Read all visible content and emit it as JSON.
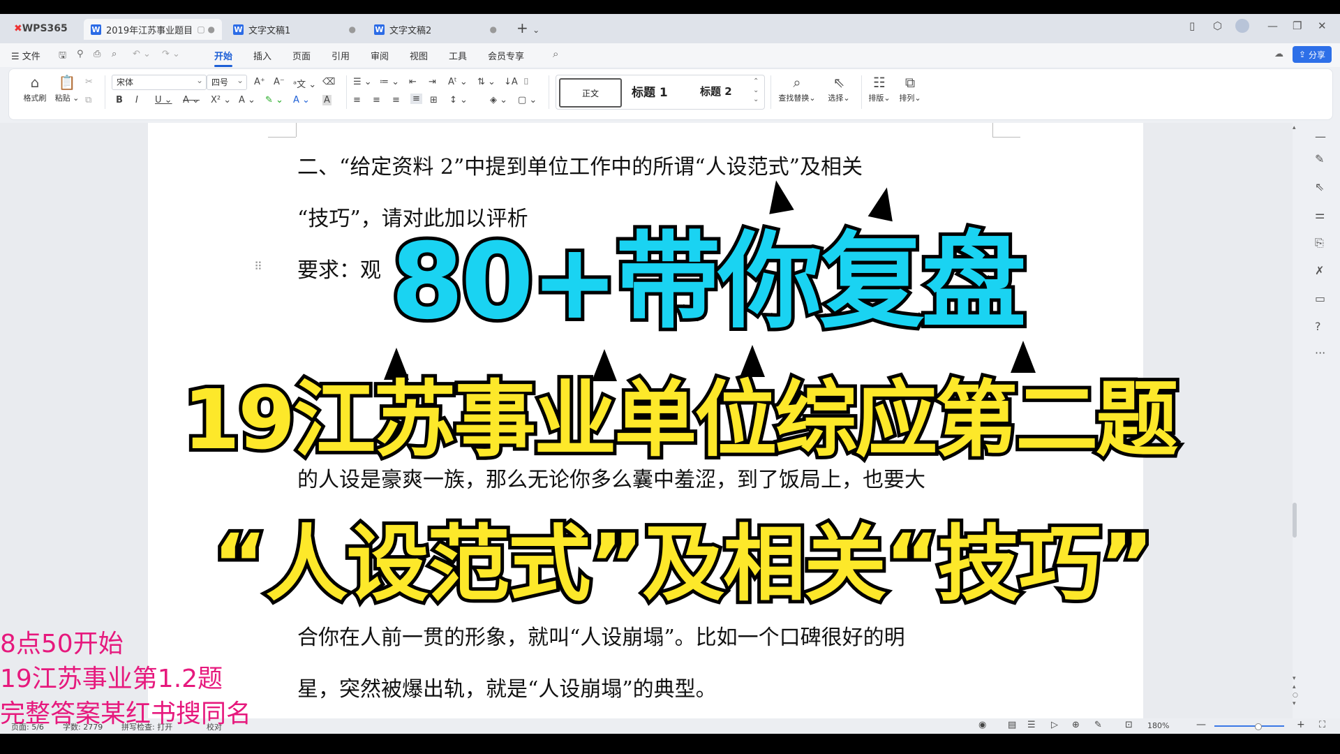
{
  "app": {
    "brand": "WPS365",
    "tabs": [
      {
        "label": "2019年江苏事业题目",
        "active": true
      },
      {
        "label": "文字文稿1",
        "active": false
      },
      {
        "label": "文字文稿2",
        "active": false
      }
    ],
    "new_tab": "+"
  },
  "menu": {
    "file": "文件",
    "items": [
      "开始",
      "插入",
      "页面",
      "引用",
      "审阅",
      "视图",
      "工具",
      "会员专享"
    ],
    "active": "开始",
    "share": "分享"
  },
  "ribbon": {
    "format_painter": "格式刷",
    "paste": "粘贴",
    "font_name": "宋体",
    "font_size": "四号",
    "style_normal": "正文",
    "style_h1": "标题 1",
    "style_h2": "标题 2",
    "find_replace": "查找替换",
    "select": "选择",
    "layout": "排版",
    "arrange": "排列"
  },
  "document": {
    "lines": [
      "二、“给定资料 2”中提到单位工作中的所谓“人设范式”及相关",
      "“技巧”，请对此加以评析",
      "要求：观",
      "的人设是豪爽一族，那么无论你多么囊中羞涩，到了饭局上，也要大",
      "合你在人前一贯的形象，就叫“人设崩塌”。比如一个口碑很好的明",
      "星，突然被爆出轨，就是“人设崩塌”的典型。"
    ]
  },
  "overlay": {
    "headline": "80+带你复盘",
    "subtitle": "19江苏事业单位综应第二题",
    "topic": "“人设范式”及相关“技巧”",
    "notes": [
      "8点50开始",
      "19江苏事业第1.2题",
      "完整答案某红书搜同名"
    ],
    "colors": {
      "headline": "#1ad3f2",
      "subtitle": "#fde82a",
      "notes": "#e6197d"
    }
  },
  "status": {
    "page": "页面: 5/6",
    "words": "字数: 2779",
    "spell": "拼写检查: 打开",
    "proof": "校对",
    "zoom": "180%"
  }
}
